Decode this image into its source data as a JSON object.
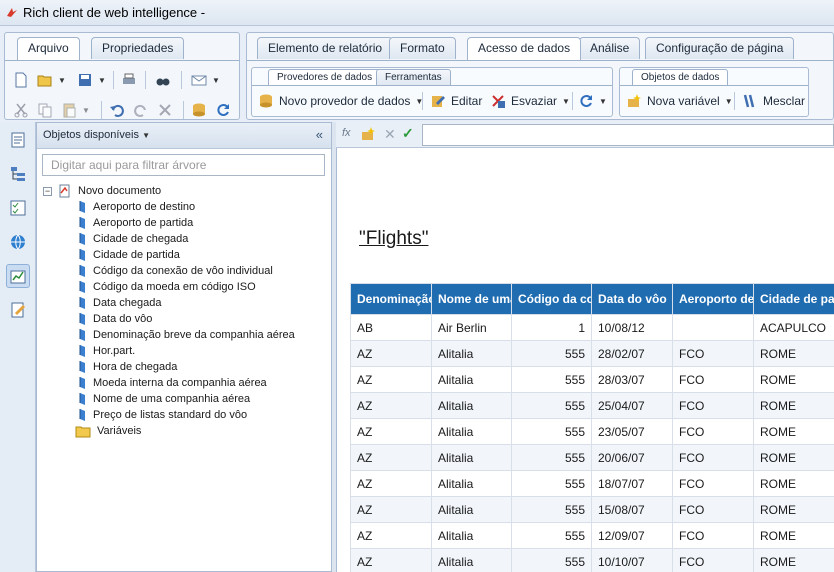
{
  "window": {
    "title": "Rich client de web intelligence -"
  },
  "ribbon": {
    "left_tabs": [
      "Arquivo",
      "Propriedades"
    ],
    "main_tabs": [
      "Elemento de relatório",
      "Formato",
      "Acesso de dados",
      "Análise",
      "Configuração de página"
    ],
    "data_subtabs": [
      "Provedores de dados",
      "Ferramentas"
    ],
    "objects_subtabs": [
      "Objetos de dados"
    ],
    "buttons": {
      "new_provider": "Novo provedor de dados",
      "edit": "Editar",
      "empty": "Esvaziar",
      "new_variable": "Nova variável",
      "merge": "Mesclar"
    }
  },
  "panel": {
    "title": "Objetos disponíveis",
    "filter_placeholder": "Digitar aqui para filtrar árvore",
    "root": "Novo documento",
    "items": [
      "Aeroporto de destino",
      "Aeroporto de partida",
      "Cidade de chegada",
      "Cidade de partida",
      "Código da conexão de vôo individual",
      "Código da moeda em código ISO",
      "Data chegada",
      "Data do vôo",
      "Denominação breve da companhia aérea",
      "Hor.part.",
      "Hora de chegada",
      "Moeda interna da companhia aérea",
      "Nome de uma companhia aérea",
      "Preço de listas standard do vôo"
    ],
    "folder": "Variáveis"
  },
  "formula": {
    "fx": "fx"
  },
  "report": {
    "title": "\"Flights\"",
    "columns": [
      "Denominação",
      "Nome de uma",
      "Código da co",
      "Data do vôo",
      "Aeroporto de",
      "Cidade de pa"
    ],
    "rows": [
      [
        "AB",
        "Air Berlin",
        "1",
        "10/08/12",
        "",
        "ACAPULCO"
      ],
      [
        "AZ",
        "Alitalia",
        "555",
        "28/02/07",
        "FCO",
        "ROME"
      ],
      [
        "AZ",
        "Alitalia",
        "555",
        "28/03/07",
        "FCO",
        "ROME"
      ],
      [
        "AZ",
        "Alitalia",
        "555",
        "25/04/07",
        "FCO",
        "ROME"
      ],
      [
        "AZ",
        "Alitalia",
        "555",
        "23/05/07",
        "FCO",
        "ROME"
      ],
      [
        "AZ",
        "Alitalia",
        "555",
        "20/06/07",
        "FCO",
        "ROME"
      ],
      [
        "AZ",
        "Alitalia",
        "555",
        "18/07/07",
        "FCO",
        "ROME"
      ],
      [
        "AZ",
        "Alitalia",
        "555",
        "15/08/07",
        "FCO",
        "ROME"
      ],
      [
        "AZ",
        "Alitalia",
        "555",
        "12/09/07",
        "FCO",
        "ROME"
      ],
      [
        "AZ",
        "Alitalia",
        "555",
        "10/10/07",
        "FCO",
        "ROME"
      ]
    ]
  },
  "colors": {
    "header_blue": "#1f6cb1",
    "accent_icon": "#2f6fbf"
  }
}
